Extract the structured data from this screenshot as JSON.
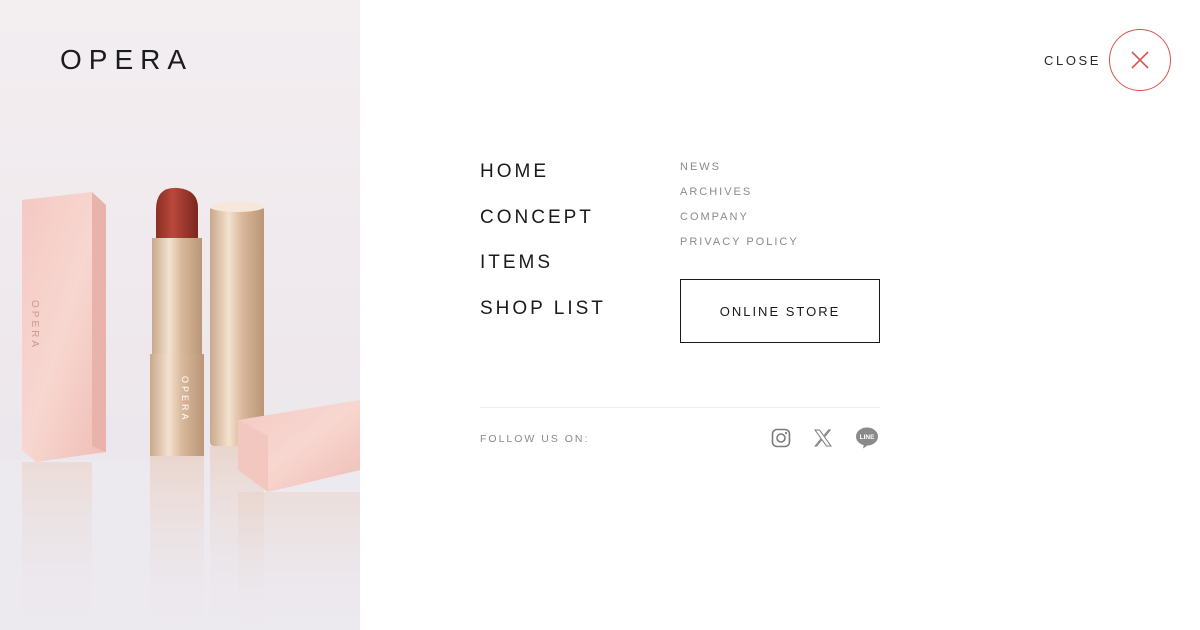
{
  "brand": {
    "logo_text": "OPERA",
    "product_print": "OPERA"
  },
  "header": {
    "close_label": "CLOSE"
  },
  "main_nav": {
    "items": [
      {
        "label": "HOME"
      },
      {
        "label": "CONCEPT"
      },
      {
        "label": "ITEMS"
      },
      {
        "label": "SHOP LIST"
      }
    ]
  },
  "sub_nav": {
    "items": [
      {
        "label": "NEWS"
      },
      {
        "label": "ARCHIVES"
      },
      {
        "label": "COMPANY"
      },
      {
        "label": "PRIVACY POLICY"
      }
    ]
  },
  "online_store": {
    "label": "ONLINE STORE"
  },
  "follow": {
    "label": "FOLLOW US ON:",
    "icons": [
      "instagram-icon",
      "x-icon",
      "line-icon"
    ],
    "line_badge_text": "LINE"
  },
  "colors": {
    "close_accent": "#d9534f",
    "text_dark": "#1a1a1a",
    "text_muted": "#8a8a8a",
    "social_icon": "#7a7a7a"
  }
}
